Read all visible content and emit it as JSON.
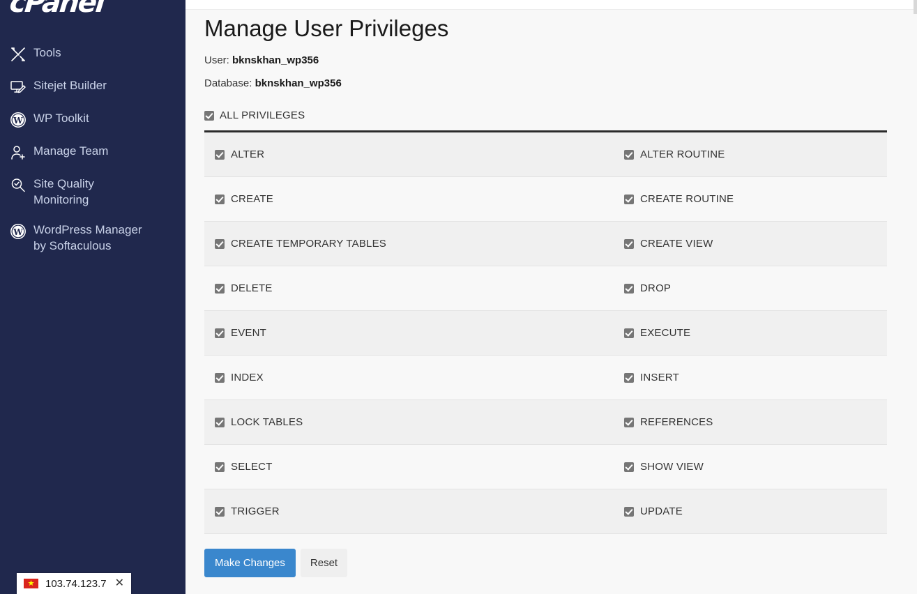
{
  "sidebar": {
    "brand": "cPanel",
    "items": [
      {
        "label": "Tools",
        "icon": "tools-icon"
      },
      {
        "label": "Sitejet Builder",
        "icon": "sitejet-builder-icon"
      },
      {
        "label": "WP Toolkit",
        "icon": "wordpress-icon"
      },
      {
        "label": "Manage Team",
        "icon": "manage-team-icon"
      },
      {
        "label": "Site Quality\nMonitoring",
        "icon": "site-quality-icon"
      },
      {
        "label": "WordPress Manager\nby Softaculous",
        "icon": "wordpress-icon"
      }
    ]
  },
  "ip_popup": {
    "ip": "103.74.123.7",
    "close_label": "✕",
    "flag": "vietnam-flag-icon",
    "flag_star": "★"
  },
  "page": {
    "title": "Manage User Privileges",
    "user_label": "User:",
    "user_value": "bknskhan_wp356",
    "database_label": "Database:",
    "database_value": "bknskhan_wp356"
  },
  "privileges": {
    "all_label": "ALL PRIVILEGES",
    "all_checked": true,
    "rows": [
      {
        "left": "ALTER",
        "left_checked": true,
        "right": "ALTER ROUTINE",
        "right_checked": true
      },
      {
        "left": "CREATE",
        "left_checked": true,
        "right": "CREATE ROUTINE",
        "right_checked": true
      },
      {
        "left": "CREATE TEMPORARY TABLES",
        "left_checked": true,
        "right": "CREATE VIEW",
        "right_checked": true
      },
      {
        "left": "DELETE",
        "left_checked": true,
        "right": "DROP",
        "right_checked": true
      },
      {
        "left": "EVENT",
        "left_checked": true,
        "right": "EXECUTE",
        "right_checked": true
      },
      {
        "left": "INDEX",
        "left_checked": true,
        "right": "INSERT",
        "right_checked": true
      },
      {
        "left": "LOCK TABLES",
        "left_checked": true,
        "right": "REFERENCES",
        "right_checked": true
      },
      {
        "left": "SELECT",
        "left_checked": true,
        "right": "SHOW VIEW",
        "right_checked": true
      },
      {
        "left": "TRIGGER",
        "left_checked": true,
        "right": "UPDATE",
        "right_checked": true
      }
    ]
  },
  "actions": {
    "make_changes": "Make Changes",
    "reset": "Reset"
  },
  "colors": {
    "sidebar_bg": "#20284d",
    "primary_button": "#3a87cd",
    "row_odd": "#f0f0f0",
    "row_even": "#f8f8f8",
    "flag_red": "#da251d"
  }
}
